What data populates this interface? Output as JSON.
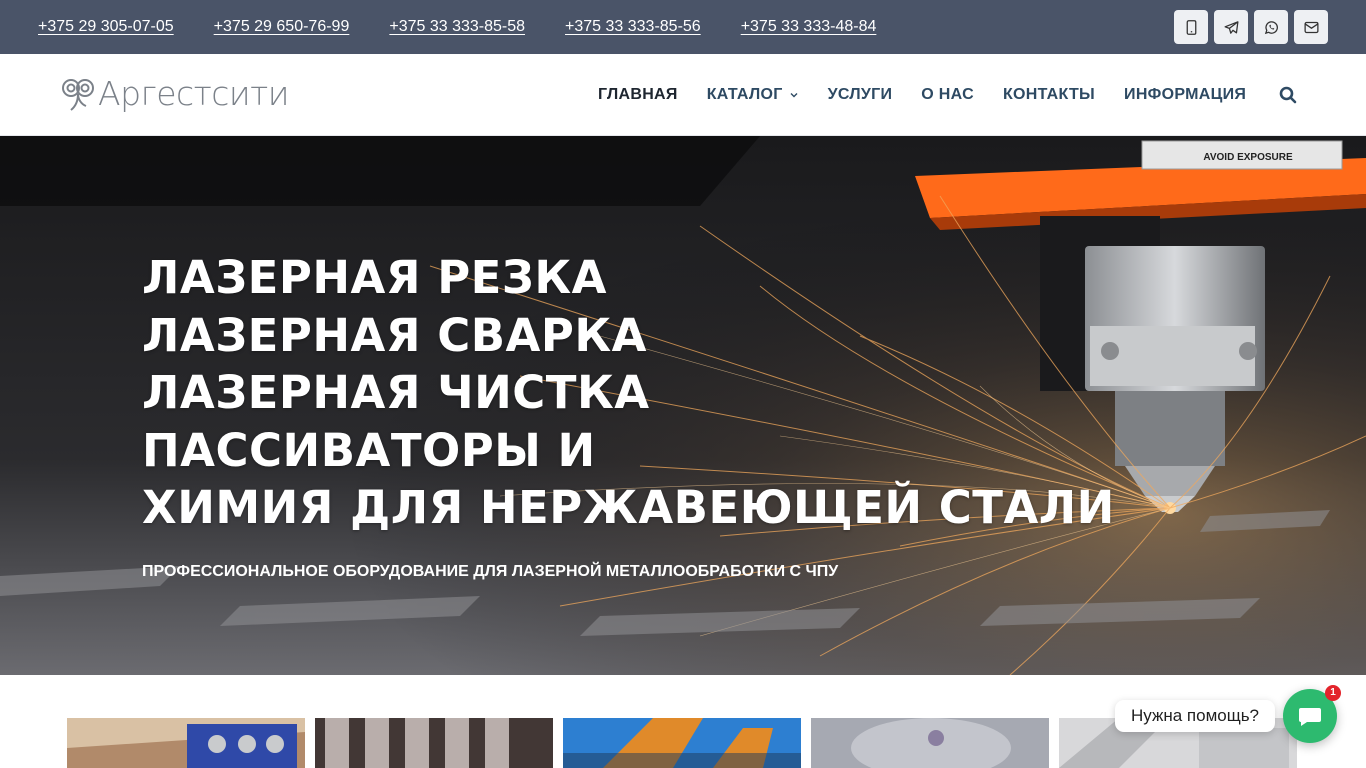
{
  "topbar": {
    "phones": [
      "+375 29 305-07-05",
      "+375 29 650-76-99",
      "+375 33 333-85-58",
      "+375 33 333-85-56",
      "+375 33 333-48-84"
    ],
    "social_icons": [
      "phone-icon",
      "telegram-icon",
      "whatsapp-icon",
      "email-icon"
    ],
    "background": "#4a5468"
  },
  "header": {
    "logo_text": "Аргестсити",
    "nav": [
      "ГЛАВНАЯ",
      "КАТАЛОГ",
      "УСЛУГИ",
      "О НАС",
      "КОНТАКТЫ",
      "ИНФОРМАЦИЯ"
    ],
    "active_nav": "ГЛАВНАЯ",
    "nav_color": "#2e4a63"
  },
  "hero": {
    "lines": [
      "ЛАЗЕРНАЯ РЕЗКА",
      "ЛАЗЕРНАЯ СВАРКА",
      "ЛАЗЕРНАЯ ЧИСТКА",
      "ПАССИВАТОРЫ И",
      "ХИМИЯ ДЛЯ НЕРЖАВЕЮЩЕЙ СТАЛИ"
    ],
    "subtitle": "ПРОФЕССИОНАЛЬНОЕ ОБОРУДОВАНИЕ ДЛЯ ЛАЗЕРНОЙ МЕТАЛЛООБРАБОТКИ С ЧПУ",
    "warning_label": "AVOID EXPOSURE",
    "accent_color": "#ff6a1a"
  },
  "chat": {
    "bubble_text": "Нужна помощь?",
    "badge_count": "1",
    "color": "#2dba6f"
  }
}
